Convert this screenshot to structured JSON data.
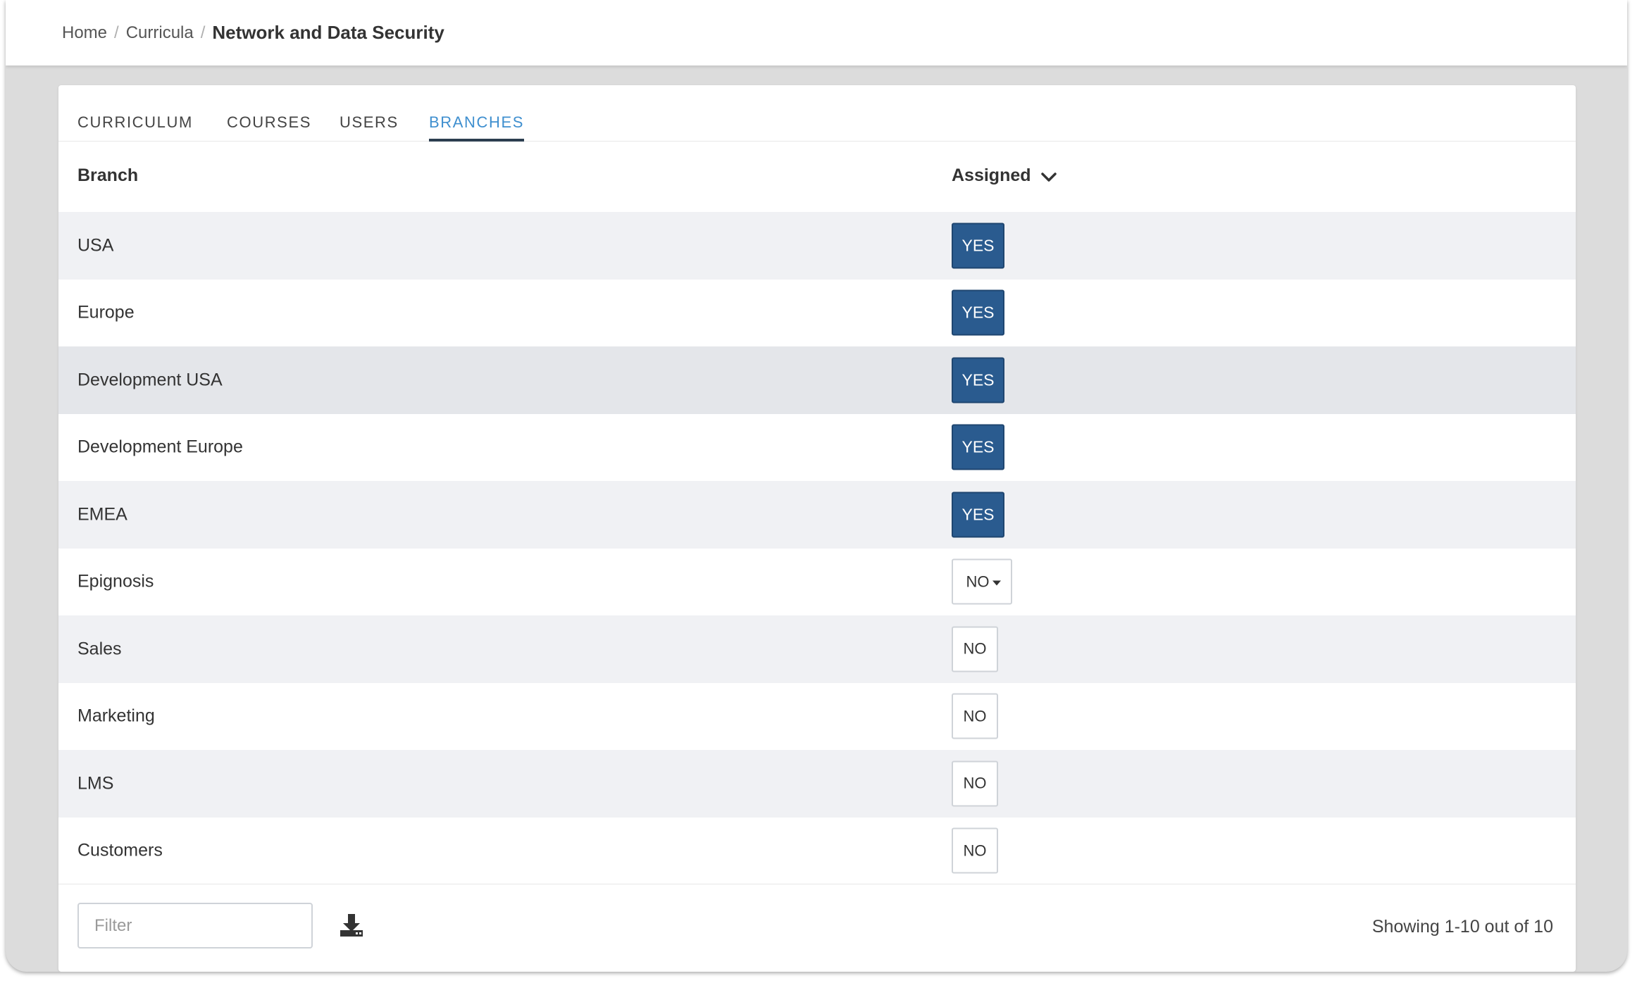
{
  "breadcrumb": {
    "home": "Home",
    "curricula": "Curricula",
    "current": "Network and Data Security"
  },
  "tabs": [
    {
      "label": "CURRICULUM",
      "active": false
    },
    {
      "label": "COURSES",
      "active": false
    },
    {
      "label": "USERS",
      "active": false
    },
    {
      "label": "BRANCHES",
      "active": true
    }
  ],
  "table": {
    "headers": {
      "branch": "Branch",
      "assigned": "Assigned"
    },
    "rows": [
      {
        "name": "USA",
        "assigned": "YES"
      },
      {
        "name": "Europe",
        "assigned": "YES"
      },
      {
        "name": "Development USA",
        "assigned": "YES"
      },
      {
        "name": "Development Europe",
        "assigned": "YES"
      },
      {
        "name": "EMEA",
        "assigned": "YES"
      },
      {
        "name": "Epignosis",
        "assigned": "NO"
      },
      {
        "name": "Sales",
        "assigned": "NO"
      },
      {
        "name": "Marketing",
        "assigned": "NO"
      },
      {
        "name": "LMS",
        "assigned": "NO"
      },
      {
        "name": "Customers",
        "assigned": "NO"
      }
    ]
  },
  "footer": {
    "filter_placeholder": "Filter",
    "filter_value": "",
    "download_icon": "download-icon",
    "showing": "Showing 1-10 out of 10"
  },
  "colors": {
    "accent_tab": "#3f8fcf",
    "yes_button": "#2a5b8f",
    "row_stripe": "#f0f1f4",
    "background": "#dcdcdc"
  }
}
